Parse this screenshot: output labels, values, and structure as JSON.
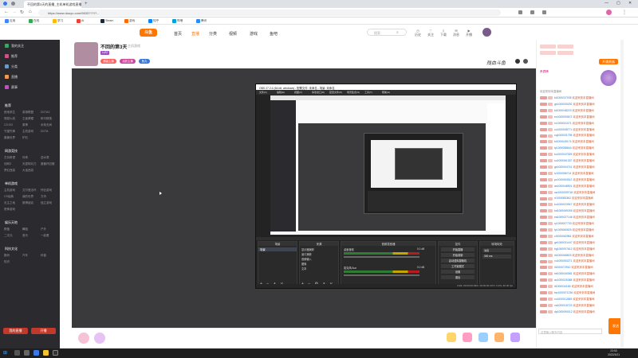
{
  "browser": {
    "tabs": [
      {
        "label": "不回的第3天的直播_主机单机游戏直播..."
      },
      {
        "label": ""
      }
    ],
    "url": "https://www.douyu.com/9833???/?...",
    "bookmarks": [
      "应用",
      "在线",
      "学习",
      "AI",
      "Steam",
      "游戏",
      "知乎",
      "哔哩",
      "腾讯"
    ]
  },
  "sidebar": {
    "items": [
      "我的关注",
      "推荐",
      "分类",
      "直播",
      "赛事",
      "排行",
      "推荐分类",
      "热门游戏",
      "最近浏览"
    ],
    "sections": [
      {
        "title": "推荐",
        "links": [
          "绝地求生",
          "英雄联盟",
          "DOTA2",
          "穿越火线",
          "王者荣耀",
          "和平精英",
          "CS:GO",
          "原神",
          "永劫无间",
          "守望先锋",
          "主机游戏",
          "DOTA",
          "魔兽世界",
          "炉石"
        ]
      },
      {
        "title": "网游竞技",
        "links": [
          "古剑奇谭",
          "传奇",
          "逆水寒",
          "剑网3",
          "天涯明月刀",
          "魔兽怀旧服",
          "梦幻西游",
          "大话西游"
        ]
      },
      {
        "title": "单机游戏",
        "links": [
          "主机游戏",
          "艾尔登法环",
          "怀旧游戏",
          "CS经典",
          "我的世界",
          "方舟",
          "无主之地",
          "赛博朋克",
          "独立游戏",
          "恐怖游戏"
        ]
      },
      {
        "title": "娱乐天地",
        "links": [
          "颜值",
          "舞蹈",
          "户外",
          "二次元",
          "音乐",
          "一起看"
        ]
      },
      {
        "title": "科技文化",
        "links": [
          "数码",
          "汽车",
          "科普",
          "知识"
        ]
      }
    ],
    "bottom_buttons": [
      "我的直播",
      "开播"
    ]
  },
  "header": {
    "logo": "斗鱼",
    "nav": [
      "首页",
      "直播",
      "分类",
      "视频",
      "游戏",
      "鱼吧"
    ],
    "search_placeholder": "搜索",
    "icons": [
      "历史",
      "关注",
      "下载",
      "消息",
      "开播"
    ]
  },
  "room": {
    "title": "不回的第3天",
    "category": "主机游戏",
    "badges": [
      "Lv22",
      "超级主播",
      "活跃主播",
      "鱼丸"
    ],
    "watermark": "残血斗鱼"
  },
  "obs": {
    "title": "OBS 27.2.4 (64-bit, windows) - 配置文件: 未命名 - 场景: 未命名",
    "menu": [
      "文件(F)",
      "编辑(E)",
      "视图(V)",
      "停靠窗口(D)",
      "配置文件(P)",
      "场景集合(S)",
      "工具(T)",
      "帮助(H)"
    ],
    "panels": [
      "场景",
      "来源",
      "音频混音器",
      "转场特效",
      "控件"
    ],
    "scene": "场景",
    "sources": [
      "显示器捕获",
      "窗口捕获",
      "音频输入",
      "图像",
      "文本"
    ],
    "mixer": [
      {
        "name": "桌面音频",
        "db": "0.0 dB"
      },
      {
        "name": "麦克风/Aux",
        "db": "0.0 dB"
      }
    ],
    "controls": [
      "开始直播",
      "开始录制",
      "启动虚拟摄像机",
      "工作室模式",
      "设置",
      "退出"
    ],
    "transition": {
      "type": "淡出",
      "duration": "300 ms"
    },
    "status": "LIVE: 00:00:00  REC: 00:00:00  CPU: 0.3%, 60.00 fps"
  },
  "chat": {
    "header_btn": "开通贵族",
    "rank_label": "贵宾榜",
    "notice": "欢迎来到本直播间",
    "message": "欢迎来到本直播间",
    "users": [
      "bi1000037035",
      "gk1000030292",
      "bi1000048223",
      "ez1000093672",
      "rv1000031071",
      "cc1000008771",
      "cq1000031795",
      "bi1000049174",
      "tp1000058844",
      "kc1000047009",
      "so1000061337",
      "gk1000004741",
      "lv1000056714",
      "pz1000063512",
      "as1000048901",
      "uw1000039718",
      "rt1000083362",
      "ko1000023947",
      "bd1000069305",
      "ea1000027146",
      "ry1000007733",
      "fp1000060829",
      "cl1000062984",
      "ge1000031447",
      "bg1000007612",
      "ih1000068823",
      "xu1000053271",
      "ii1000072910",
      "hb1000040581",
      "ac1000026388",
      "lt1000034165",
      "bw1000071236",
      "cc1000012845",
      "va1000015723",
      "dp1000090012"
    ],
    "input_placeholder": "这里输入聊天内容",
    "send_label": "发送"
  },
  "gifts": [
    "荧光棒",
    "办卡",
    "飞机",
    "火箭"
  ],
  "taskbar": {
    "time": "23:53",
    "date": "2022/3/21"
  },
  "colors": {
    "accent": "#ff7700",
    "chat_name": "#2a77c9",
    "chat_msg": "#d35a2a",
    "dark": "#2b2b2f"
  }
}
